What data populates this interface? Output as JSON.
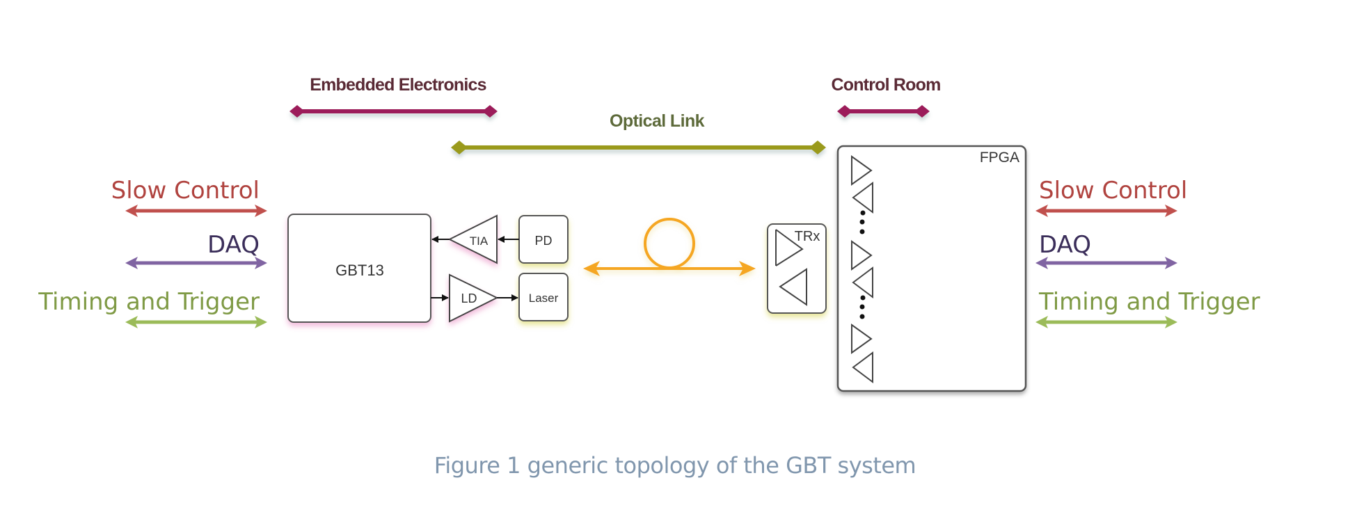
{
  "headers": {
    "embedded": "Embedded Electronics",
    "optical": "Optical Link",
    "control_room": "Control Room"
  },
  "left_signals": [
    {
      "label": "Slow Control",
      "color": "#c0504d"
    },
    {
      "label": "DAQ",
      "color": "#8064a2",
      "text_color": "#3b2e5a"
    },
    {
      "label": "Timing and Trigger",
      "color": "#9bbb59",
      "text_color": "#7f9a45"
    }
  ],
  "right_signals": [
    {
      "label": "Slow Control",
      "color": "#c0504d"
    },
    {
      "label": "DAQ",
      "color": "#8064a2",
      "text_color": "#3b2e5a"
    },
    {
      "label": "Timing and Trigger",
      "color": "#9bbb59",
      "text_color": "#7f9a45"
    }
  ],
  "blocks": {
    "gbt": "GBT13",
    "tia": "TIA",
    "pd": "PD",
    "ld": "LD",
    "laser": "Laser",
    "trx": "TRx",
    "fpga": "FPGA"
  },
  "colors": {
    "bracket_magenta": "#9c1f5a",
    "bracket_olive": "#9a9a1c",
    "fiber_orange": "#f5a623",
    "header_text": "#5a2a35",
    "optical_text": "#5d6a3a"
  },
  "caption": "Figure 1 generic topology of the GBT system"
}
